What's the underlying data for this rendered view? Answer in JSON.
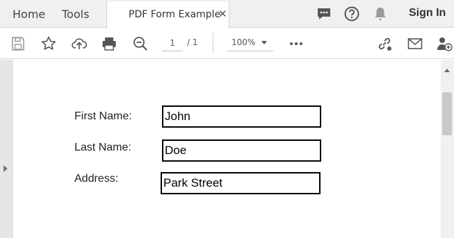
{
  "header": {
    "tabs": [
      "Home",
      "Tools"
    ],
    "document_tab": {
      "title": "PDF Form Example",
      "close": "✕"
    },
    "sign_in": "Sign In",
    "icons": [
      "comment-icon",
      "help-icon",
      "notifications-bell-icon"
    ]
  },
  "toolbar": {
    "page_current": "1",
    "page_total": "/ 1",
    "zoom": "100%",
    "icons": [
      "save-icon",
      "bookmark-star-icon",
      "upload-cloud-icon",
      "print-icon",
      "zoom-out-icon",
      "more-icon",
      "share-link-icon",
      "email-icon",
      "add-user-icon"
    ]
  },
  "form": {
    "first_name": {
      "label": "First Name:",
      "value": "John"
    },
    "last_name": {
      "label": "Last Name:",
      "value": "Doe"
    },
    "address": {
      "label": "Address:",
      "value": "Park Street"
    }
  },
  "colors": {
    "toolbar_bg": "#f0f0f0",
    "viewer_bg": "#e2e2e2",
    "icon": "#555555"
  }
}
